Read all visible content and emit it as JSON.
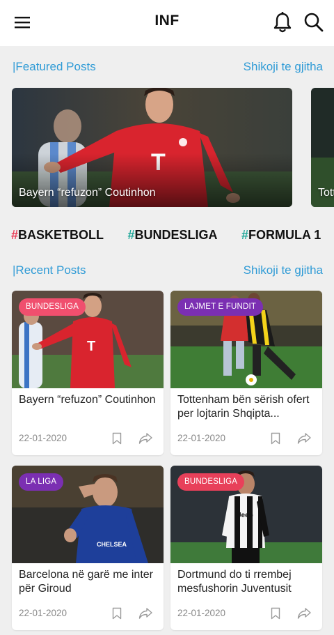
{
  "app": {
    "title": "INF"
  },
  "icons": {
    "menu": "menu-icon",
    "notifications": "bell-icon",
    "search": "search-icon",
    "bookmark": "bookmark-icon",
    "share": "share-icon"
  },
  "featured_section": {
    "title": "|Featured Posts",
    "see_all": "Shikoji te gjitha",
    "cards": [
      {
        "caption": "Bayern “refuzon” Coutinhon"
      },
      {
        "caption": "Tottenham"
      }
    ]
  },
  "tags": [
    {
      "hash": "#",
      "label": "BASKETBOLL",
      "hash_color": "#e8405a"
    },
    {
      "hash": "#",
      "label": "BUNDESLIGA",
      "hash_color": "#22a89a"
    },
    {
      "hash": "#",
      "label": "FORMULA 1",
      "hash_color": "#22a89a"
    }
  ],
  "recent_section": {
    "title": "|Recent Posts",
    "see_all": "Shikoji te gjitha",
    "posts": [
      {
        "badge": "BUNDESLIGA",
        "badge_color": "#f04f6e",
        "title": "Bayern “refuzon” Coutinhon",
        "date": "22-01-2020"
      },
      {
        "badge": "LAJMET E FUNDIT",
        "badge_color": "#7b2fb2",
        "title": "Tottenham bën sërish ofert per lojtarin Shqipta...",
        "date": "22-01-2020"
      },
      {
        "badge": "LA LIGA",
        "badge_color": "#7b2fb2",
        "title": "Barcelona në garë me inter për Giroud",
        "date": "22-01-2020"
      },
      {
        "badge": "BUNDESLIGA",
        "badge_color": "#e8405a",
        "title": "Dortmund do ti rrembej mesfushorin Juventusit",
        "date": "22-01-2020"
      }
    ]
  },
  "colors": {
    "accent": "#2f9bd6",
    "background": "#efefef"
  }
}
